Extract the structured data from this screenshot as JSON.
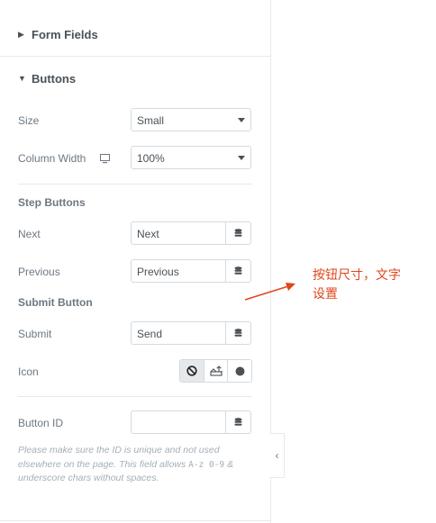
{
  "sections": {
    "form_fields": "Form Fields",
    "buttons": "Buttons"
  },
  "fields": {
    "size_label": "Size",
    "size_value": "Small",
    "column_width_label": "Column Width",
    "column_width_value": "100%",
    "step_buttons_heading": "Step Buttons",
    "next_label": "Next",
    "next_value": "Next",
    "previous_label": "Previous",
    "previous_value": "Previous",
    "submit_button_heading": "Submit Button",
    "submit_label": "Submit",
    "submit_value": "Send",
    "icon_label": "Icon",
    "button_id_label": "Button ID",
    "button_id_value": "",
    "description_before": "Please make sure the ID is unique and not used elsewhere on the page. This field allows ",
    "description_code": "A-z  0-9",
    "description_after": " & underscore chars without spaces."
  },
  "annotation": {
    "line1": "按钮尺寸，文字",
    "line2": "设置",
    "color": "#e0461d"
  }
}
